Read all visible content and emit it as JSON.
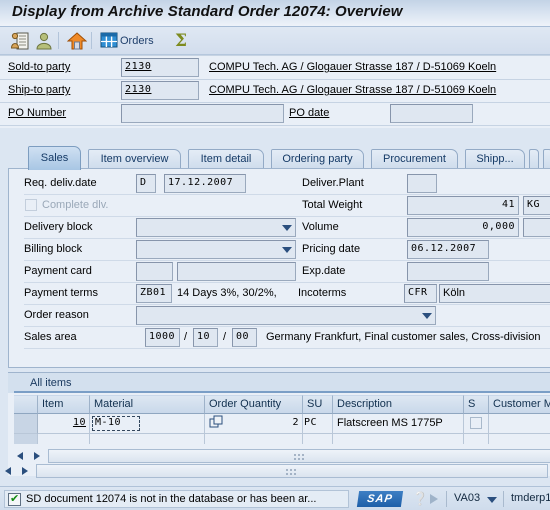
{
  "window": {
    "title": "Display from Archive Standard Order 12074: Overview"
  },
  "toolbar": {
    "items": [
      {
        "name": "document-person-icon",
        "label": ""
      },
      {
        "name": "person-icon",
        "label": ""
      },
      {
        "name": "home-icon",
        "label": ""
      },
      {
        "name": "orders-icon",
        "label": "Orders"
      },
      {
        "name": "sigma-icon",
        "label": ""
      }
    ],
    "orders_label": "Orders"
  },
  "header": {
    "sold_to_label": "Sold-to party",
    "sold_to_value": "2130",
    "sold_to_desc": "COMPU Tech. AG / Glogauer Strasse 187 / D-51069 Koeln",
    "ship_to_label": "Ship-to party",
    "ship_to_value": "2130",
    "ship_to_desc": "COMPU Tech. AG / Glogauer Strasse 187 / D-51069 Koeln",
    "po_number_label": "PO Number",
    "po_number_value": "",
    "po_date_label": "PO date",
    "po_date_value": ""
  },
  "tabs": [
    {
      "label": "Sales",
      "active": true
    },
    {
      "label": "Item overview",
      "active": false
    },
    {
      "label": "Item detail",
      "active": false
    },
    {
      "label": "Ordering party",
      "active": false
    },
    {
      "label": "Procurement",
      "active": false
    },
    {
      "label": "Shipp...",
      "active": false
    }
  ],
  "sales_form": {
    "req_deliv_date_label": "Req. deliv.date",
    "req_deliv_date_type": "D",
    "req_deliv_date_value": "17.12.2007",
    "deliver_plant_label": "Deliver.Plant",
    "deliver_plant_value": "",
    "complete_dlv_label": "Complete dlv.",
    "complete_dlv_checked": false,
    "total_weight_label": "Total Weight",
    "total_weight_value": "41",
    "total_weight_unit": "KG",
    "delivery_block_label": "Delivery block",
    "delivery_block_value": "",
    "volume_label": "Volume",
    "volume_value": "0,000",
    "volume_unit": "",
    "billing_block_label": "Billing block",
    "billing_block_value": "",
    "pricing_date_label": "Pricing date",
    "pricing_date_value": "06.12.2007",
    "payment_card_label": "Payment card",
    "payment_card_value": "",
    "payment_card_value2": "",
    "exp_date_label": "Exp.date",
    "exp_date_value": "",
    "payment_terms_label": "Payment terms",
    "payment_terms_key": "ZB01",
    "payment_terms_desc": "14 Days 3%, 30/2%, ",
    "incoterms_label": "Incoterms",
    "incoterms_key": "CFR",
    "incoterms_city": "Köln",
    "order_reason_label": "Order reason",
    "order_reason_value": "",
    "sales_area_label": "Sales area",
    "sales_area_org": "1000",
    "sales_area_channel": "10",
    "sales_area_division": "00",
    "sales_area_sep1": "/",
    "sales_area_sep2": "/",
    "sales_area_desc": "Germany Frankfurt, Final customer sales, Cross-division"
  },
  "items_table": {
    "title": "All items",
    "columns": [
      {
        "label": "",
        "key": "sel"
      },
      {
        "label": "Item",
        "key": "item"
      },
      {
        "label": "Material",
        "key": "material"
      },
      {
        "label": "Order Quantity",
        "key": "qty"
      },
      {
        "label": "SU",
        "key": "su"
      },
      {
        "label": "Description",
        "key": "description"
      },
      {
        "label": "S",
        "key": "s"
      },
      {
        "label": "Customer Ma",
        "key": "customer_material"
      }
    ],
    "rows": [
      {
        "item": "10",
        "material": "M-10",
        "qty": "2",
        "su": "PC",
        "description": "Flatscreen MS 1775P",
        "s": false,
        "customer_material": ""
      }
    ]
  },
  "status_bar": {
    "message": "SD document 12074 is not in the database or has been ar...",
    "icon": "success-check-icon",
    "brand": "SAP",
    "transaction": "VA03",
    "server": "tmderp1"
  },
  "colors": {
    "accent": "#2b4f7e",
    "panel_bg": "#e9eff7",
    "field_bg": "#dfe7f1",
    "title_bg": "#d7e2f0",
    "tab_active": "#a8c6e4",
    "sap_blue": "#1e5fa8",
    "check_green": "#128a12"
  }
}
